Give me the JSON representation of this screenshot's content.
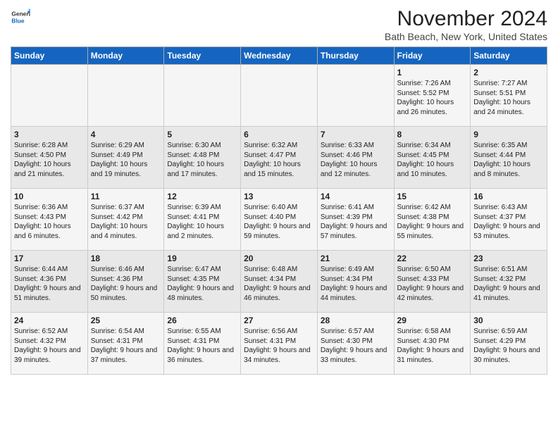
{
  "header": {
    "logo_line1": "General",
    "logo_line2": "Blue",
    "month": "November 2024",
    "location": "Bath Beach, New York, United States"
  },
  "days_of_week": [
    "Sunday",
    "Monday",
    "Tuesday",
    "Wednesday",
    "Thursday",
    "Friday",
    "Saturday"
  ],
  "weeks": [
    [
      {
        "day": "",
        "info": ""
      },
      {
        "day": "",
        "info": ""
      },
      {
        "day": "",
        "info": ""
      },
      {
        "day": "",
        "info": ""
      },
      {
        "day": "",
        "info": ""
      },
      {
        "day": "1",
        "info": "Sunrise: 7:26 AM\nSunset: 5:52 PM\nDaylight: 10 hours and 26 minutes."
      },
      {
        "day": "2",
        "info": "Sunrise: 7:27 AM\nSunset: 5:51 PM\nDaylight: 10 hours and 24 minutes."
      }
    ],
    [
      {
        "day": "3",
        "info": "Sunrise: 6:28 AM\nSunset: 4:50 PM\nDaylight: 10 hours and 21 minutes."
      },
      {
        "day": "4",
        "info": "Sunrise: 6:29 AM\nSunset: 4:49 PM\nDaylight: 10 hours and 19 minutes."
      },
      {
        "day": "5",
        "info": "Sunrise: 6:30 AM\nSunset: 4:48 PM\nDaylight: 10 hours and 17 minutes."
      },
      {
        "day": "6",
        "info": "Sunrise: 6:32 AM\nSunset: 4:47 PM\nDaylight: 10 hours and 15 minutes."
      },
      {
        "day": "7",
        "info": "Sunrise: 6:33 AM\nSunset: 4:46 PM\nDaylight: 10 hours and 12 minutes."
      },
      {
        "day": "8",
        "info": "Sunrise: 6:34 AM\nSunset: 4:45 PM\nDaylight: 10 hours and 10 minutes."
      },
      {
        "day": "9",
        "info": "Sunrise: 6:35 AM\nSunset: 4:44 PM\nDaylight: 10 hours and 8 minutes."
      }
    ],
    [
      {
        "day": "10",
        "info": "Sunrise: 6:36 AM\nSunset: 4:43 PM\nDaylight: 10 hours and 6 minutes."
      },
      {
        "day": "11",
        "info": "Sunrise: 6:37 AM\nSunset: 4:42 PM\nDaylight: 10 hours and 4 minutes."
      },
      {
        "day": "12",
        "info": "Sunrise: 6:39 AM\nSunset: 4:41 PM\nDaylight: 10 hours and 2 minutes."
      },
      {
        "day": "13",
        "info": "Sunrise: 6:40 AM\nSunset: 4:40 PM\nDaylight: 9 hours and 59 minutes."
      },
      {
        "day": "14",
        "info": "Sunrise: 6:41 AM\nSunset: 4:39 PM\nDaylight: 9 hours and 57 minutes."
      },
      {
        "day": "15",
        "info": "Sunrise: 6:42 AM\nSunset: 4:38 PM\nDaylight: 9 hours and 55 minutes."
      },
      {
        "day": "16",
        "info": "Sunrise: 6:43 AM\nSunset: 4:37 PM\nDaylight: 9 hours and 53 minutes."
      }
    ],
    [
      {
        "day": "17",
        "info": "Sunrise: 6:44 AM\nSunset: 4:36 PM\nDaylight: 9 hours and 51 minutes."
      },
      {
        "day": "18",
        "info": "Sunrise: 6:46 AM\nSunset: 4:36 PM\nDaylight: 9 hours and 50 minutes."
      },
      {
        "day": "19",
        "info": "Sunrise: 6:47 AM\nSunset: 4:35 PM\nDaylight: 9 hours and 48 minutes."
      },
      {
        "day": "20",
        "info": "Sunrise: 6:48 AM\nSunset: 4:34 PM\nDaylight: 9 hours and 46 minutes."
      },
      {
        "day": "21",
        "info": "Sunrise: 6:49 AM\nSunset: 4:34 PM\nDaylight: 9 hours and 44 minutes."
      },
      {
        "day": "22",
        "info": "Sunrise: 6:50 AM\nSunset: 4:33 PM\nDaylight: 9 hours and 42 minutes."
      },
      {
        "day": "23",
        "info": "Sunrise: 6:51 AM\nSunset: 4:32 PM\nDaylight: 9 hours and 41 minutes."
      }
    ],
    [
      {
        "day": "24",
        "info": "Sunrise: 6:52 AM\nSunset: 4:32 PM\nDaylight: 9 hours and 39 minutes."
      },
      {
        "day": "25",
        "info": "Sunrise: 6:54 AM\nSunset: 4:31 PM\nDaylight: 9 hours and 37 minutes."
      },
      {
        "day": "26",
        "info": "Sunrise: 6:55 AM\nSunset: 4:31 PM\nDaylight: 9 hours and 36 minutes."
      },
      {
        "day": "27",
        "info": "Sunrise: 6:56 AM\nSunset: 4:31 PM\nDaylight: 9 hours and 34 minutes."
      },
      {
        "day": "28",
        "info": "Sunrise: 6:57 AM\nSunset: 4:30 PM\nDaylight: 9 hours and 33 minutes."
      },
      {
        "day": "29",
        "info": "Sunrise: 6:58 AM\nSunset: 4:30 PM\nDaylight: 9 hours and 31 minutes."
      },
      {
        "day": "30",
        "info": "Sunrise: 6:59 AM\nSunset: 4:29 PM\nDaylight: 9 hours and 30 minutes."
      }
    ]
  ]
}
